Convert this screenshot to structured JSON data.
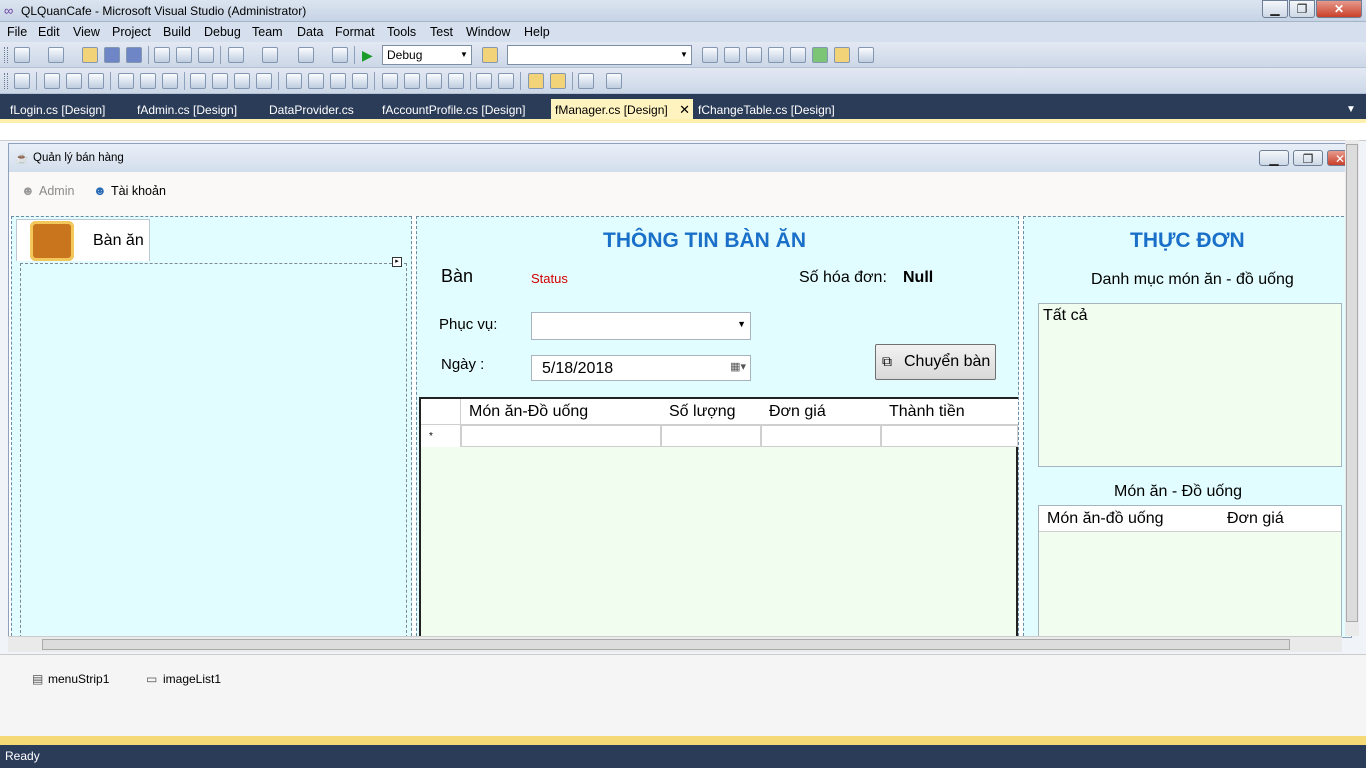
{
  "window": {
    "title": "QLQuanCafe - Microsoft Visual Studio (Administrator)",
    "min_label": "▁",
    "max_label": "❐",
    "close_label": "✕"
  },
  "menu": [
    "File",
    "Edit",
    "View",
    "Project",
    "Build",
    "Debug",
    "Team",
    "Data",
    "Format",
    "Tools",
    "Test",
    "Window",
    "Help"
  ],
  "toolbar": {
    "config": "Debug",
    "platform": ""
  },
  "tabs": [
    "fLogin.cs [Design]",
    "fAdmin.cs [Design]",
    "DataProvider.cs",
    "fAccountProfile.cs [Design]",
    "fManager.cs [Design]",
    "fChangeTable.cs [Design]"
  ],
  "form": {
    "title": "Quản lý bán hàng",
    "menu": {
      "admin": "Admin",
      "account": "Tài khoản"
    },
    "left": {
      "tab": "Bàn ăn"
    },
    "center": {
      "heading": "THÔNG TIN BÀN ĂN",
      "ban": "Bàn",
      "status": "Status",
      "invoice_label": "Số hóa đơn:",
      "invoice_value": "Null",
      "serve_label": "Phục vụ:",
      "date_label": "Ngày :",
      "date_value": "5/18/2018",
      "move_button": "Chuyển bàn",
      "grid_headers": [
        "Món ăn-Đồ uống",
        "Số lượng",
        "Đơn giá",
        "Thành tiền"
      ],
      "new_row_marker": "*"
    },
    "right": {
      "heading": "THỰC ĐƠN",
      "category_label": "Danh mục món  ăn - đồ uống",
      "category_item": "Tất cả",
      "dishes_label": "Món  ăn - Đồ uống",
      "grid_headers": [
        "Món ăn-đồ uống",
        "Đơn giá"
      ]
    }
  },
  "tray": {
    "menustrip": "menuStrip1",
    "imagelist": "imageList1"
  },
  "status": "Ready"
}
